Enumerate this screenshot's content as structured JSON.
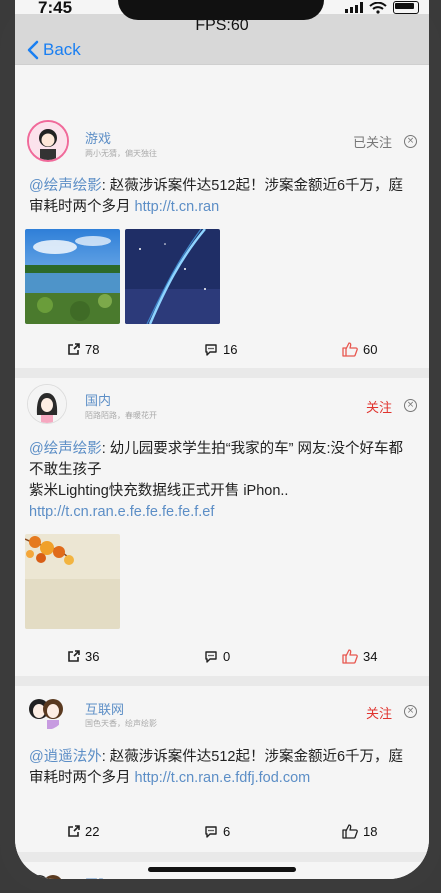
{
  "status": {
    "time": "7:45"
  },
  "nav": {
    "title": "FPS:60",
    "back_label": "Back"
  },
  "posts": [
    {
      "username": "游戏",
      "subtitle": "两小无猜，偏天独往",
      "follow": "已关注",
      "mention": "@绘声绘影",
      "text": ": 赵薇涉诉案件达512起！涉案金额近6千万，庭审耗时两个多月 ",
      "link": "http://t.cn.ran",
      "shares": "78",
      "comments": "16",
      "likes": "60"
    },
    {
      "username": "国内",
      "subtitle": "陌路陌路，春暖花开",
      "follow": "关注",
      "mention": "@绘声绘影",
      "text": ": 幼儿园要求学生拍“我家的车” 网友:没个好车都不敢生孩子",
      "text2": "紫米Lighting快充数据线正式开售 iPhon.. ",
      "link": "http://t.cn.ran.e.fe.fe.fe.fe.f.ef",
      "shares": "36",
      "comments": "0",
      "likes": "34"
    },
    {
      "username": "互联网",
      "subtitle": "国色天香，绘声绘影",
      "follow": "关注",
      "mention": "@逍遥法外",
      "text": ": 赵薇涉诉案件达512起！涉案金额近6千万，庭审耗时两个多月 ",
      "link": "http://t.cn.ran.e.fdfj.fod.com",
      "shares": "22",
      "comments": "6",
      "likes": "18"
    },
    {
      "username": "国际"
    }
  ],
  "colors": {
    "accent": "#1a7ff2",
    "link": "#5c8ec6",
    "follow_red": "#e0342f",
    "followed_gray": "#777777",
    "like_red": "#e8574f"
  }
}
